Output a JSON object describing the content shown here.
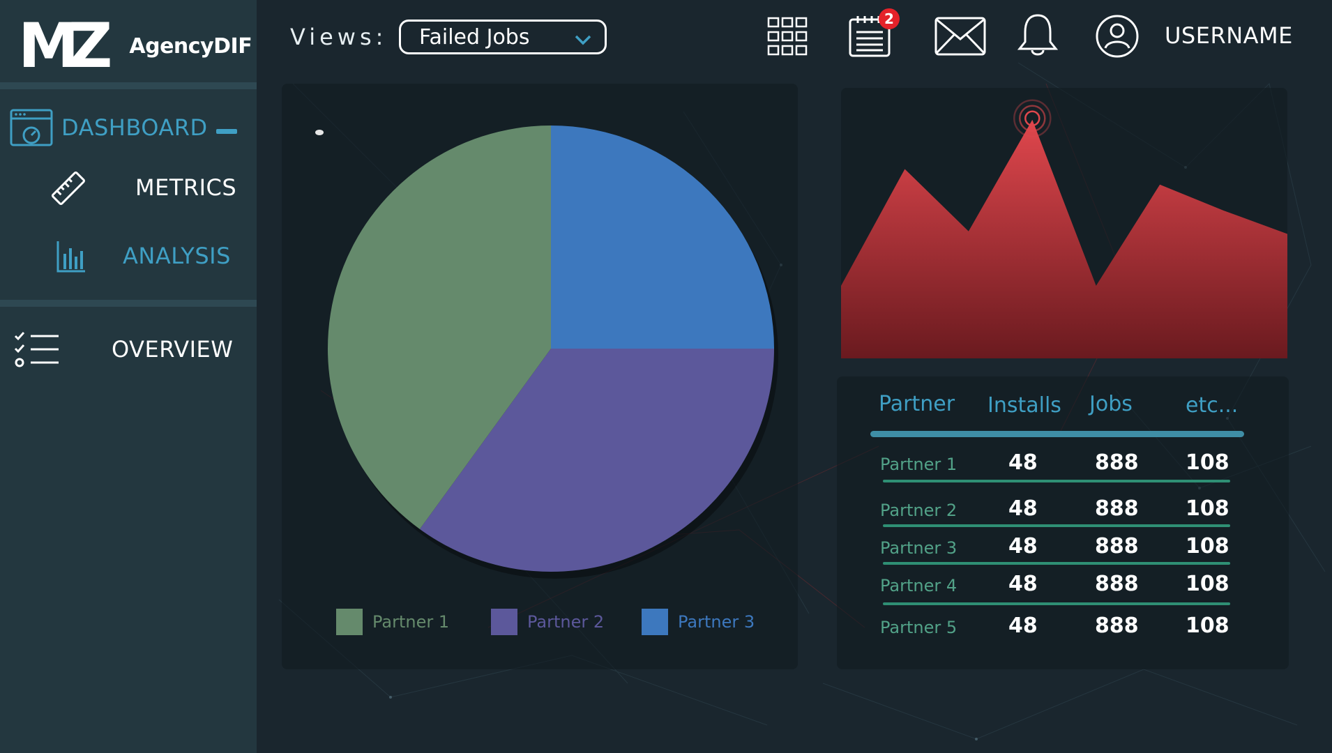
{
  "brand": {
    "logo_mark": "MZ",
    "name": "AgencyDIF"
  },
  "sidebar": {
    "items": [
      {
        "label": "DASHBOARD",
        "icon": "dashboard-gauge-icon",
        "active": true,
        "trailing": "collapse-dash-icon"
      },
      {
        "label": "METRICS",
        "icon": "ruler-icon"
      },
      {
        "label": "ANALYSIS",
        "icon": "bar-chart-icon",
        "highlighted": true
      },
      {
        "label": "OVERVIEW",
        "icon": "checklist-icon"
      }
    ]
  },
  "topbar": {
    "views_label": "Views:",
    "views_selected": "Failed Jobs",
    "icons": [
      "grid-apps-icon",
      "notepad-icon",
      "mail-icon",
      "bell-icon",
      "user-avatar-icon"
    ],
    "notification_count": "2",
    "username": "USERNAME"
  },
  "colors": {
    "sidebar_bg": "#23373f",
    "page_bg": "#1a262e",
    "accent": "#3f9fc4",
    "partner1": "#658a6c",
    "partner2": "#5c589b",
    "partner3": "#3d78be",
    "area_top": "#e0474d",
    "area_bottom": "#6a1a1f",
    "table_rule": "#2f8f74",
    "badge": "#e4222a"
  },
  "chart_data": [
    {
      "type": "pie",
      "categories": [
        "Partner 1",
        "Partner 2",
        "Partner 3"
      ],
      "values": [
        40,
        35,
        25
      ],
      "legend": [
        "Partner 1",
        "Partner 2",
        "Partner 3"
      ],
      "legend_position": "bottom"
    },
    {
      "type": "area",
      "x": [
        0,
        1,
        2,
        3,
        4,
        5,
        6,
        7
      ],
      "values": [
        28,
        73,
        49,
        92,
        28,
        67,
        57,
        48
      ],
      "ylim": [
        0,
        100
      ],
      "grid": false,
      "marker": {
        "x": 3,
        "icon": "pulse-target-icon"
      }
    },
    {
      "type": "table",
      "columns": [
        "Partner",
        "Installs",
        "Jobs",
        "etc..."
      ],
      "rows": [
        [
          "Partner 1",
          "48",
          "888",
          "108"
        ],
        [
          "Partner 2",
          "48",
          "888",
          "108"
        ],
        [
          "Partner 3",
          "48",
          "888",
          "108"
        ],
        [
          "Partner 4",
          "48",
          "888",
          "108"
        ],
        [
          "Partner 5",
          "48",
          "888",
          "108"
        ]
      ]
    }
  ]
}
